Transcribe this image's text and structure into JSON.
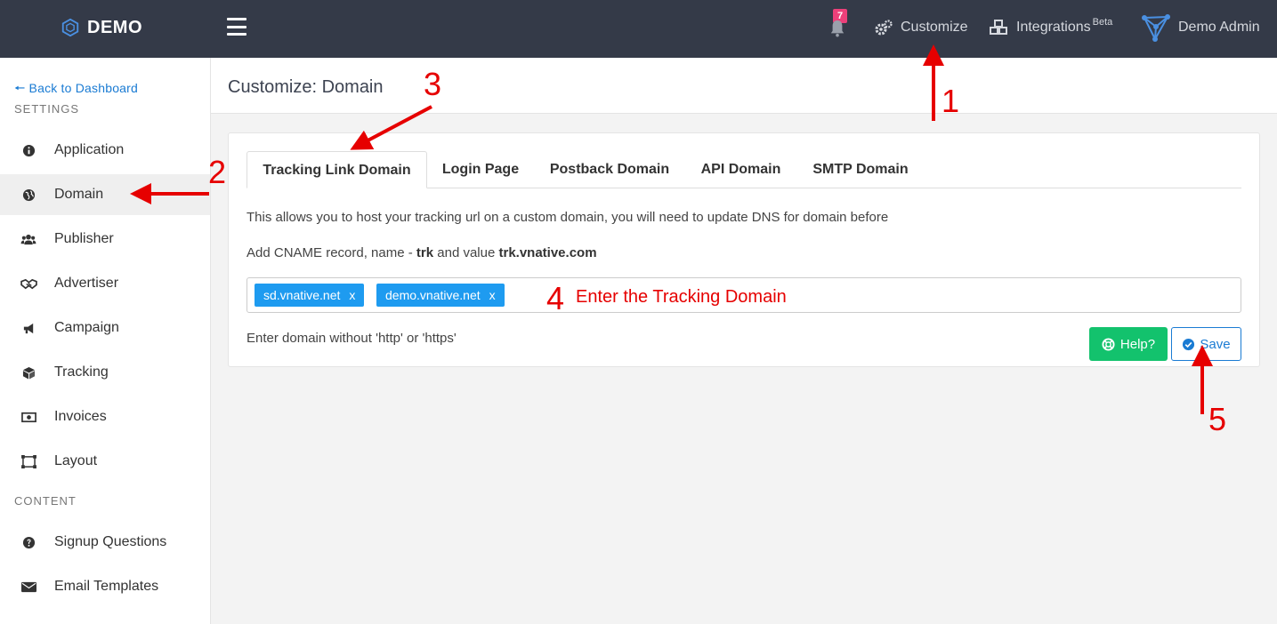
{
  "topbar": {
    "brand": "DEMO",
    "notification_count": "7",
    "customize": "Customize",
    "integrations": "Integrations",
    "integrations_sup": "Beta",
    "user": "Demo Admin"
  },
  "sidebar": {
    "back": "Back to Dashboard",
    "settings_label": "SETTINGS",
    "content_label": "CONTENT",
    "items": [
      {
        "label": "Application",
        "icon": "info-circle-icon"
      },
      {
        "label": "Domain",
        "icon": "globe-icon"
      },
      {
        "label": "Publisher",
        "icon": "users-icon"
      },
      {
        "label": "Advertiser",
        "icon": "handshake-icon"
      },
      {
        "label": "Campaign",
        "icon": "bullhorn-icon"
      },
      {
        "label": "Tracking",
        "icon": "cube-icon"
      },
      {
        "label": "Invoices",
        "icon": "money-icon"
      },
      {
        "label": "Layout",
        "icon": "layout-icon"
      }
    ],
    "content_items": [
      {
        "label": "Signup Questions",
        "icon": "question-circle-icon"
      },
      {
        "label": "Email Templates",
        "icon": "envelope-icon"
      }
    ],
    "active": "Domain"
  },
  "page": {
    "title": "Customize: Domain",
    "tabs": [
      "Tracking Link Domain",
      "Login Page",
      "Postback Domain",
      "API Domain",
      "SMTP Domain"
    ],
    "active_tab": "Tracking Link Domain",
    "description": "This allows you to host your tracking url on a custom domain, you will need to update DNS for domain before",
    "cname_prefix": "Add CNAME record, name - ",
    "cname_name": "trk",
    "cname_mid": " and value ",
    "cname_value": "trk.vnative.com",
    "tags": [
      "sd.vnative.net",
      "demo.vnative.net"
    ],
    "tag_remove": "x",
    "hint": "Enter domain without 'http' or 'https'",
    "help_button": "Help?",
    "save_button": "Save"
  },
  "annotations": {
    "step1": "1",
    "step2": "2",
    "step3": "3",
    "step4": "4",
    "step4_text": "Enter the Tracking Domain",
    "step5": "5"
  },
  "colors": {
    "topbar": "#343a48",
    "accent": "#1a7bd3",
    "tag": "#1e9bf0",
    "help": "#13c26d",
    "badge": "#ec407a",
    "annotation": "#e60000"
  }
}
